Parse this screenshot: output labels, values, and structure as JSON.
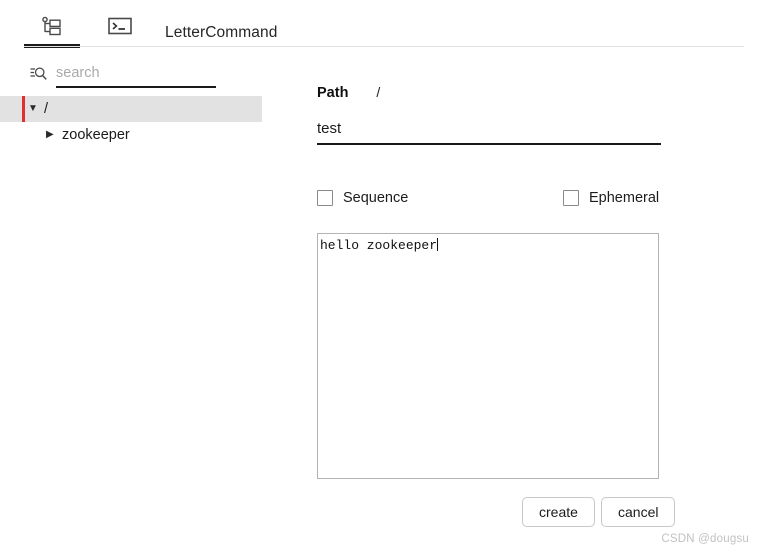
{
  "window": {
    "title": "LetterCommand"
  },
  "tabs": [
    {
      "id": "tree",
      "icon": "tree-view-icon",
      "active": true
    },
    {
      "id": "terminal",
      "icon": "terminal-icon",
      "active": false
    }
  ],
  "sidebar": {
    "search": {
      "icon": "filter-search-icon",
      "placeholder": "search",
      "value": ""
    },
    "tree": [
      {
        "label": "/",
        "expanded": true,
        "selected": true,
        "level": 0,
        "caret": "▼"
      },
      {
        "label": "zookeeper",
        "expanded": false,
        "selected": false,
        "level": 1,
        "caret": "▶"
      }
    ]
  },
  "detail": {
    "path_label": "Path",
    "path_value": "/",
    "name_value": "test",
    "name_placeholder": "",
    "options": [
      {
        "id": "sequence",
        "label": "Sequence",
        "checked": false
      },
      {
        "id": "ephemeral",
        "label": "Ephemeral",
        "checked": false
      }
    ],
    "data_value": "hello zookeeper",
    "buttons": [
      {
        "id": "create",
        "label": "create"
      },
      {
        "id": "cancel",
        "label": "cancel"
      }
    ]
  },
  "watermark": "CSDN @dougsu",
  "colors": {
    "accent_red": "#e03030",
    "active_tab_underline": "#1b1b1b",
    "selected_row_bg": "#e2e2e2",
    "divider": "#e3e3e3"
  }
}
